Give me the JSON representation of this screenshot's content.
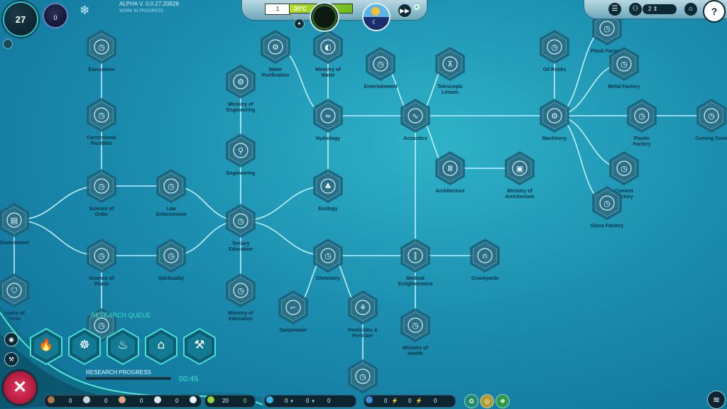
{
  "hud": {
    "population": "27",
    "small_counter": "0",
    "version": "ALPHA V.  0.0.27.20828",
    "version_note": "WORK IN PROGRESS",
    "temp_value": "1",
    "temp_label": "30°C",
    "speed_icon": "fast-forward-icon",
    "workers_count": "2"
  },
  "colors": {
    "node_fill": "#2c6f86",
    "node_ring": "#3e92a6",
    "edge": "#c6f6ff",
    "accent": "#3be3c8"
  },
  "tree": {
    "nodes": [
      {
        "id": "executions",
        "label": "Executions",
        "label2": "",
        "icon": "timer-icon"
      },
      {
        "id": "correctional",
        "label": "Correctional",
        "label2": "Facilities",
        "icon": "timer-icon"
      },
      {
        "id": "science_order",
        "label": "Science of",
        "label2": "Order",
        "icon": "timer-icon"
      },
      {
        "id": "law_enforcement",
        "label": "Law",
        "label2": "Enforcement",
        "icon": "timer-icon"
      },
      {
        "id": "science_peace",
        "label": "Science of",
        "label2": "Peace",
        "icon": "timer-icon"
      },
      {
        "id": "spirituality",
        "label": "Spirituality",
        "label2": "",
        "icon": "timer-icon"
      },
      {
        "id": "government",
        "label": "Government",
        "label2": "",
        "icon": "document-icon"
      },
      {
        "id": "ministry_defense",
        "label": "inistry of",
        "label2": "fense",
        "icon": "shield-icon"
      },
      {
        "id": "queue_hidden",
        "label": "",
        "label2": "",
        "icon": "timer-icon"
      },
      {
        "id": "ministry_engineering",
        "label": "Ministry of",
        "label2": "Engineering",
        "icon": "gear-icon"
      },
      {
        "id": "engineering",
        "label": "Engineering",
        "label2": "",
        "icon": "compass-icon"
      },
      {
        "id": "tertiary_education",
        "label": "Tertiary",
        "label2": "Education",
        "icon": "timer-icon"
      },
      {
        "id": "ministry_education",
        "label": "Ministry of",
        "label2": "Education",
        "icon": "timer-icon"
      },
      {
        "id": "water_purification",
        "label": "Water",
        "label2": "Purification",
        "icon": "gear-icon"
      },
      {
        "id": "ministry_water",
        "label": "Ministry of",
        "label2": "Water",
        "icon": "drop-icon"
      },
      {
        "id": "hydrology",
        "label": "Hydrology",
        "label2": "",
        "icon": "water-icon"
      },
      {
        "id": "ecology",
        "label": "Ecology",
        "label2": "",
        "icon": "tree-icon"
      },
      {
        "id": "chemistry",
        "label": "Chemistry",
        "label2": "",
        "icon": "timer-icon"
      },
      {
        "id": "gunpowder",
        "label": "Gunpowder",
        "label2": "",
        "icon": "gun-icon"
      },
      {
        "id": "pesticides",
        "label": "Pesticides &",
        "label2": "Fertilizer",
        "icon": "wheat-icon"
      },
      {
        "id": "bottom_hidden",
        "label": "",
        "label2": "",
        "icon": "timer-icon"
      },
      {
        "id": "entertainment",
        "label": "Entertainment",
        "label2": "",
        "icon": "timer-icon"
      },
      {
        "id": "telescopic",
        "label": "Telescopic",
        "label2": "Lenses",
        "icon": "telescope-icon"
      },
      {
        "id": "acoustics",
        "label": "Acoustics",
        "label2": "",
        "icon": "sound-icon"
      },
      {
        "id": "architecture",
        "label": "Architecture",
        "label2": "",
        "icon": "column-icon"
      },
      {
        "id": "ministry_architecture",
        "label": "Ministry of",
        "label2": "Architecture",
        "icon": "building-icon"
      },
      {
        "id": "medical",
        "label": "Medical",
        "label2": "Enlightenment",
        "icon": "syringe-icon"
      },
      {
        "id": "graveyards",
        "label": "Graveyards",
        "label2": "",
        "icon": "tomb-icon"
      },
      {
        "id": "ministry_health",
        "label": "Ministry of",
        "label2": "Health",
        "icon": "timer-icon"
      },
      {
        "id": "oil_rocks",
        "label": "Oil Rocks",
        "label2": "",
        "icon": "timer-icon"
      },
      {
        "id": "plank_factory",
        "label": "Plank Factory",
        "label2": "",
        "icon": "timer-icon"
      },
      {
        "id": "metal_factory",
        "label": "Metal Factory",
        "label2": "",
        "icon": "timer-icon"
      },
      {
        "id": "machinery",
        "label": "Machinery",
        "label2": "",
        "icon": "gear-icon"
      },
      {
        "id": "plastic_factory",
        "label": "Plastic",
        "label2": "Factory",
        "icon": "timer-icon"
      },
      {
        "id": "coming_soon",
        "label": "Coming Soon",
        "label2": "",
        "icon": "timer-icon"
      },
      {
        "id": "cement_factory",
        "label": "Cement",
        "label2": "Factory",
        "icon": "timer-icon"
      },
      {
        "id": "glass_factory",
        "label": "Glass Factory",
        "label2": "",
        "icon": "timer-icon"
      }
    ]
  },
  "research": {
    "queue_title": "RESEARCH QUEUE",
    "progress_label": "RESEARCH PROGRESS",
    "progress_time": "00:45",
    "progress_fraction": 0.0,
    "queue": [
      {
        "icon": "fire-icon"
      },
      {
        "icon": "wheel-icon"
      },
      {
        "icon": "bath-icon"
      },
      {
        "icon": "factory-icon"
      },
      {
        "icon": "tools-icon"
      }
    ]
  },
  "resources": {
    "group1": [
      "0",
      "0",
      "0",
      "0"
    ],
    "food": "20",
    "food_extra": "0",
    "group3": [
      "0",
      "0",
      "0"
    ],
    "group4": [
      "0",
      "0",
      "0"
    ]
  }
}
